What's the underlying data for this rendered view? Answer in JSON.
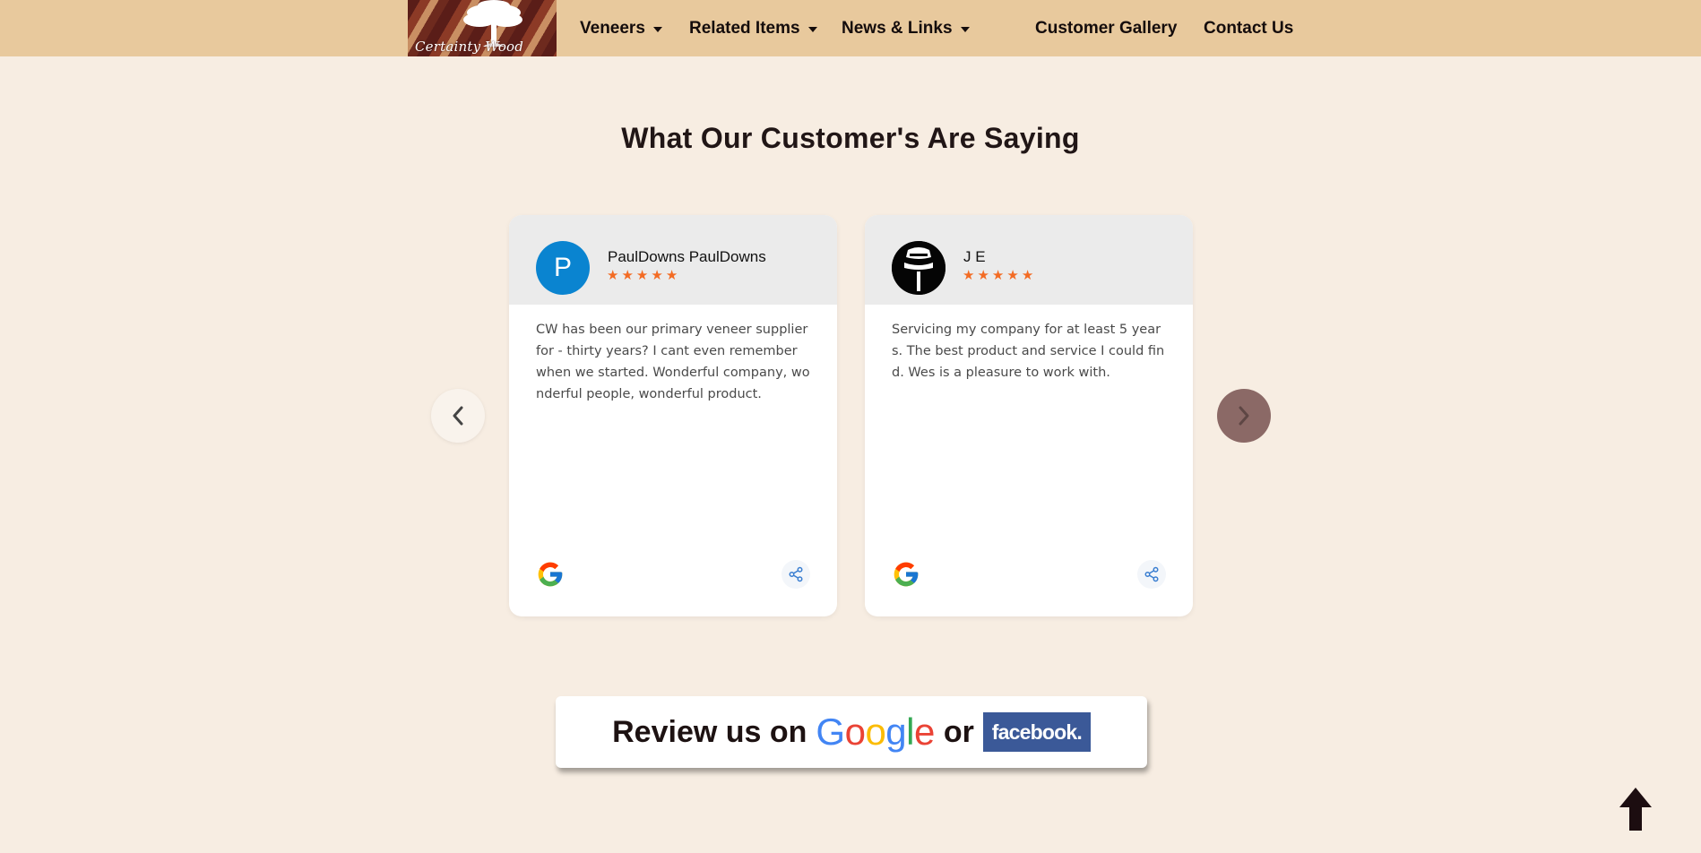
{
  "nav": {
    "logo_text": "Certainty Wood",
    "items": [
      {
        "label": "Veneers",
        "has_dropdown": true
      },
      {
        "label": "Related Items",
        "has_dropdown": true
      },
      {
        "label": "News & Links",
        "has_dropdown": true
      },
      {
        "label": "Customer Gallery",
        "has_dropdown": false
      },
      {
        "label": "Contact Us",
        "has_dropdown": false
      }
    ]
  },
  "testimonials": {
    "heading": "What Our Customer's Are Saying",
    "star_color": "#f36b23",
    "reviews": [
      {
        "name": "PaulDowns PaulDowns",
        "avatar_letter": "P",
        "avatar_color": "#0a84d0",
        "rating": 5,
        "rating_max": 5,
        "source_icon": "google-icon",
        "text": "CW has been our primary veneer supplier for - thirty years? I cant even remember when we started. Wonderful company, wonderful people, wonderful product."
      },
      {
        "name": "J E",
        "avatar_letter": "",
        "avatar_color": "#050505",
        "rating": 5,
        "rating_max": 5,
        "source_icon": "google-icon",
        "text": "Servicing my company for at least 5 years. The best product and service I could find. Wes is a pleasure to work with."
      }
    ]
  },
  "review_banner": {
    "prefix": "Review us on",
    "google": "Google",
    "or": "or",
    "facebook": "facebook.",
    "facebook_color": "#3b5998"
  }
}
